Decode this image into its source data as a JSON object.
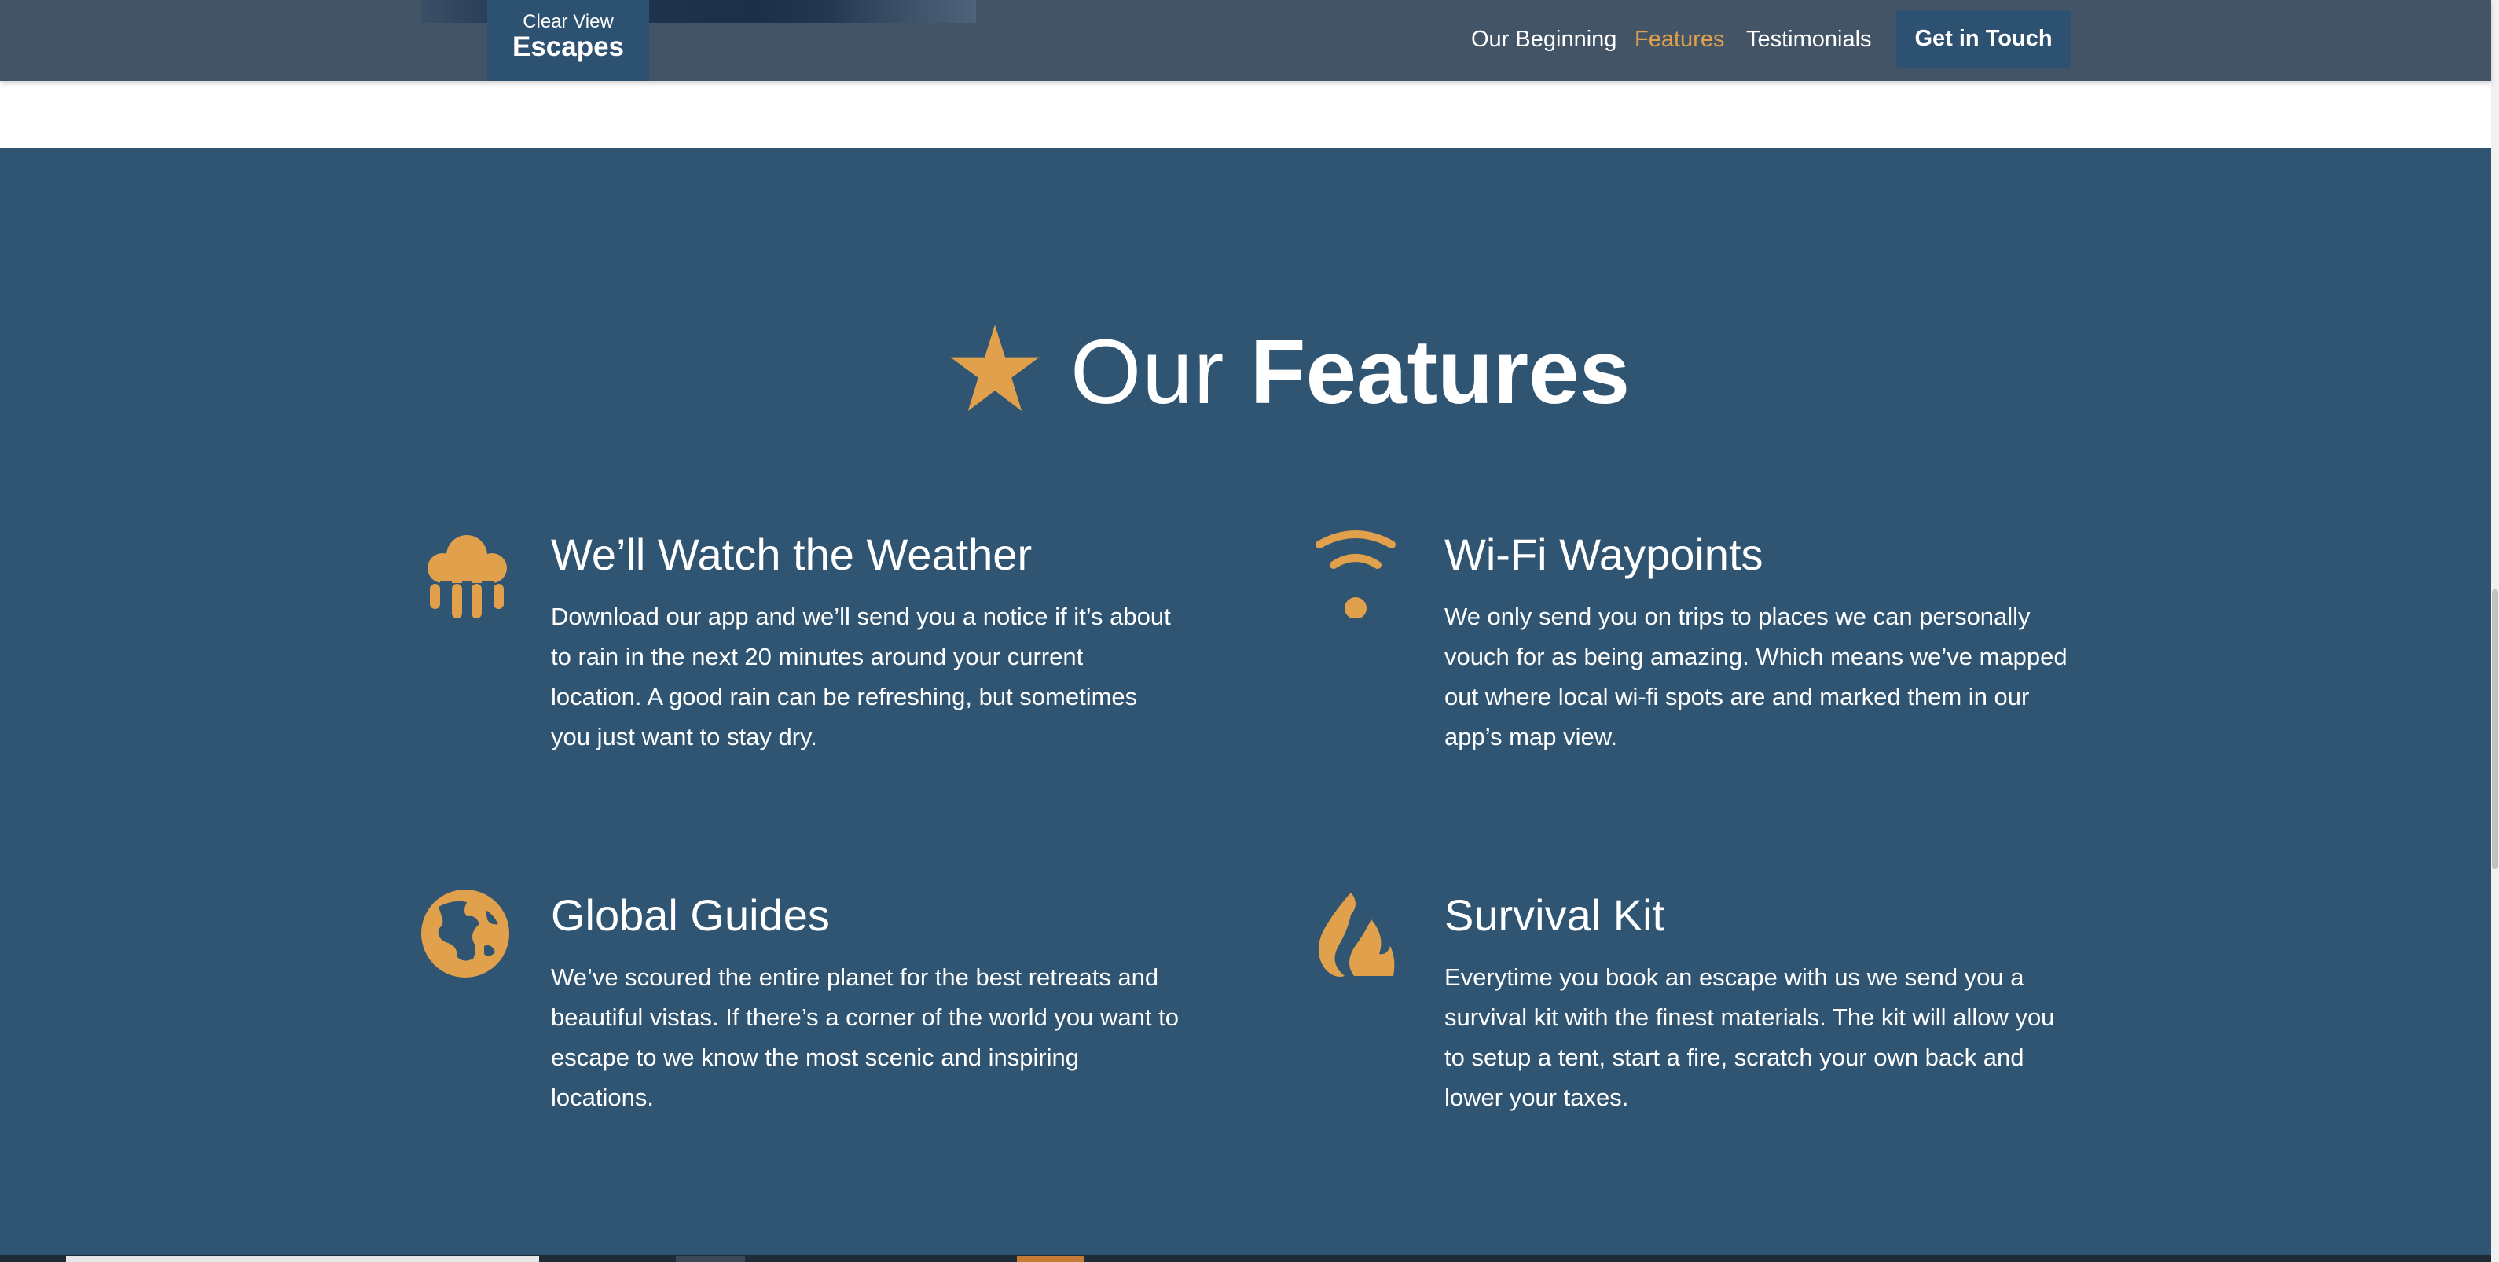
{
  "header": {
    "logo": {
      "line1": "Clear View",
      "line2": "Escapes"
    },
    "nav": [
      {
        "label": "Our Beginning",
        "active": false
      },
      {
        "label": "Features",
        "active": true
      },
      {
        "label": "Testimonials",
        "active": false
      }
    ],
    "cta_label": "Get in Touch"
  },
  "features_section": {
    "title_light": "Our",
    "title_bold": "Features",
    "title_icon": "star-icon",
    "items": [
      {
        "icon": "cloud-rain-icon",
        "title": "We’ll Watch the Weather",
        "text": "Download our app and we’ll send you a notice if it’s about to rain in the next 20 minutes around your current location. A good rain can be refreshing, but sometimes you just want to stay dry."
      },
      {
        "icon": "wifi-icon",
        "title": "Wi-Fi Waypoints",
        "text": "We only send you on trips to places we can personally vouch for as being amazing. Which means we’ve mapped out where local wi-fi spots are and marked them in our app’s map view."
      },
      {
        "icon": "globe-icon",
        "title": "Global Guides",
        "text": "We’ve scoured the entire planet for the best retreats and beautiful vistas. If there’s a corner of the world you want to escape to we know the most scenic and inspiring locations."
      },
      {
        "icon": "fire-icon",
        "title": "Survival Kit",
        "text": "Everytime you book an escape with us we send you a survival kit with the finest materials. The kit will allow you to setup a tent, start a fire, scratch your own back and lower your taxes."
      }
    ]
  },
  "colors": {
    "header_bg": "#435467",
    "section_bg": "#305572",
    "accent": "#e1a04c",
    "logo_bg": "#2d5170"
  }
}
